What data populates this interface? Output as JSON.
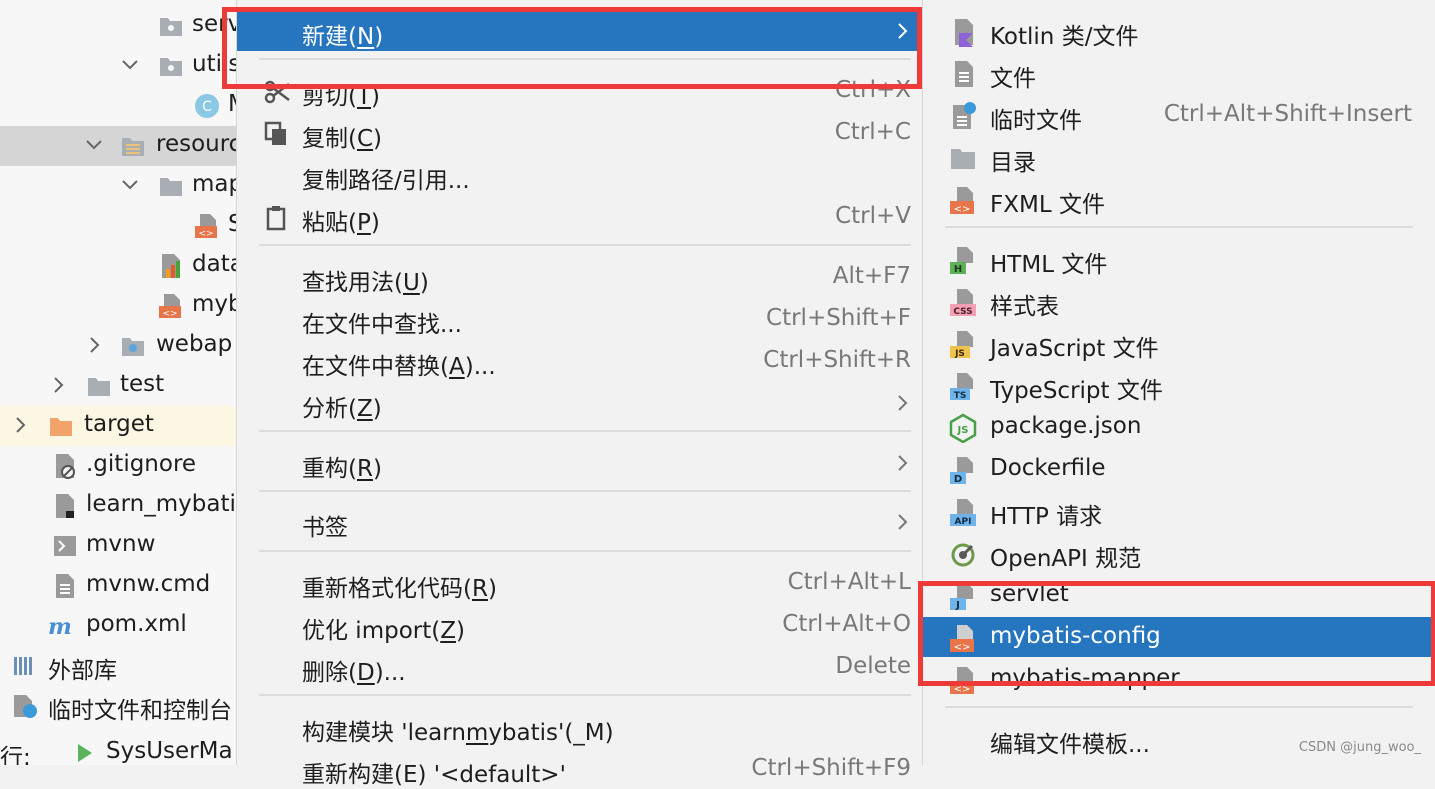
{
  "tree": {
    "rows": [
      {
        "label": "serv"
      },
      {
        "label": "utils"
      },
      {
        "label": "M"
      },
      {
        "label": "resourc"
      },
      {
        "label": "map"
      },
      {
        "label": "S"
      },
      {
        "label": "data"
      },
      {
        "label": "myb"
      },
      {
        "label": "webap"
      },
      {
        "label": "test"
      },
      {
        "label": "target"
      },
      {
        "label": ".gitignore"
      },
      {
        "label": "learn_mybatis"
      },
      {
        "label": "mvnw"
      },
      {
        "label": "mvnw.cmd"
      },
      {
        "label": "pom.xml"
      },
      {
        "label": "外部库"
      },
      {
        "label": "临时文件和控制台"
      }
    ],
    "status": {
      "label": "行:",
      "tab": "SysUserMa"
    }
  },
  "menu": {
    "items": [
      {
        "pre": "新建(",
        "key": "N",
        "post": ")",
        "shortcut": ""
      },
      {
        "pre": "剪切(",
        "key": "T",
        "post": ")",
        "shortcut": "Ctrl+X"
      },
      {
        "pre": "复制(",
        "key": "C",
        "post": ")",
        "shortcut": "Ctrl+C"
      },
      {
        "pre": "复制路径/引用...",
        "key": "",
        "post": "",
        "shortcut": ""
      },
      {
        "pre": "粘贴(",
        "key": "P",
        "post": ")",
        "shortcut": "Ctrl+V"
      },
      {
        "pre": "查找用法(",
        "key": "U",
        "post": ")",
        "shortcut": "Alt+F7"
      },
      {
        "pre": "在文件中查找...",
        "key": "",
        "post": "",
        "shortcut": "Ctrl+Shift+F"
      },
      {
        "pre": "在文件中替换(",
        "key": "A",
        "post": ")...",
        "shortcut": "Ctrl+Shift+R"
      },
      {
        "pre": "分析(",
        "key": "Z",
        "post": ")",
        "shortcut": ""
      },
      {
        "pre": "重构(",
        "key": "R",
        "post": ")",
        "shortcut": ""
      },
      {
        "pre": "书签",
        "key": "",
        "post": "",
        "shortcut": ""
      },
      {
        "pre": "重新格式化代码(",
        "key": "R",
        "post": ")",
        "shortcut": "Ctrl+Alt+L"
      },
      {
        "pre": "优化 import(",
        "key": "Z",
        "post": ")",
        "shortcut": "Ctrl+Alt+O"
      },
      {
        "pre": "删除(",
        "key": "D",
        "post": ")...",
        "shortcut": "Delete"
      },
      {
        "pre": "构建模块 'learn",
        "key": "m",
        "post": "ybatis'(_M)",
        "shortcut": ""
      },
      {
        "pre": "重新构建(E) '<default>'",
        "key": "",
        "post": "",
        "shortcut": "Ctrl+Shift+F9"
      }
    ]
  },
  "submenu": {
    "items": [
      {
        "label": "Kotlin 类/文件",
        "shortcut": "",
        "icon": "kotlin-icon"
      },
      {
        "label": "文件",
        "shortcut": "",
        "icon": "file-icon"
      },
      {
        "label": "临时文件",
        "shortcut": "Ctrl+Alt+Shift+Insert",
        "icon": "scratch-file-icon"
      },
      {
        "label": "目录",
        "shortcut": "",
        "icon": "folder-icon"
      },
      {
        "label": "FXML 文件",
        "shortcut": "",
        "icon": "fxml-icon"
      },
      {
        "label": "HTML 文件",
        "shortcut": "",
        "icon": "html-icon"
      },
      {
        "label": "样式表",
        "shortcut": "",
        "icon": "css-icon"
      },
      {
        "label": "JavaScript 文件",
        "shortcut": "",
        "icon": "javascript-icon"
      },
      {
        "label": "TypeScript 文件",
        "shortcut": "",
        "icon": "typescript-icon"
      },
      {
        "label": "package.json",
        "shortcut": "",
        "icon": "nodejs-icon"
      },
      {
        "label": "Dockerfile",
        "shortcut": "",
        "icon": "docker-icon"
      },
      {
        "label": "HTTP 请求",
        "shortcut": "",
        "icon": "http-api-icon"
      },
      {
        "label": "OpenAPI 规范",
        "shortcut": "",
        "icon": "openapi-icon"
      },
      {
        "label": "servlet",
        "shortcut": "",
        "icon": "servlet-icon"
      },
      {
        "label": "mybatis-config",
        "shortcut": "",
        "icon": "xml-template-icon"
      },
      {
        "label": "mybatis-mapper",
        "shortcut": "",
        "icon": "xml-template-icon"
      },
      {
        "label": "编辑文件模板...",
        "shortcut": "",
        "icon": ""
      }
    ]
  },
  "watermark": "CSDN @jung_woo_",
  "colors": {
    "highlight": "#2675bf",
    "annotation_box": "#ef3a3a"
  }
}
